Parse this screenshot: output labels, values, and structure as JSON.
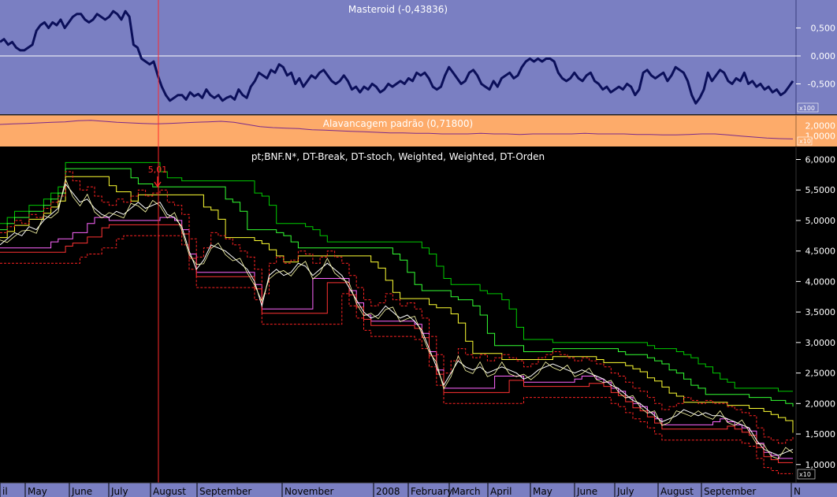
{
  "chart_data": [
    {
      "type": "line",
      "title": "Masteroid (-0,43836)",
      "multiplier_label": "x100",
      "y_ticks": [
        "0,500",
        "0,000",
        "-0,500"
      ],
      "ylim": [
        -1.0,
        1.0
      ],
      "zero_line": true,
      "colors": {
        "background": "#7a7fc2",
        "line": "#0b0f5a",
        "reference": "#ffffff"
      },
      "values": [
        0.25,
        0.3,
        0.2,
        0.25,
        0.15,
        0.1,
        0.1,
        0.15,
        0.2,
        0.45,
        0.55,
        0.6,
        0.5,
        0.6,
        0.55,
        0.65,
        0.5,
        0.6,
        0.7,
        0.75,
        0.75,
        0.65,
        0.6,
        0.65,
        0.75,
        0.7,
        0.65,
        0.7,
        0.8,
        0.75,
        0.65,
        0.8,
        0.7,
        0.2,
        0.15,
        -0.05,
        -0.1,
        -0.15,
        -0.1,
        -0.35,
        -0.55,
        -0.7,
        -0.8,
        -0.75,
        -0.7,
        -0.7,
        -0.78,
        -0.65,
        -0.72,
        -0.68,
        -0.75,
        -0.6,
        -0.7,
        -0.75,
        -0.7,
        -0.8,
        -0.75,
        -0.72,
        -0.78,
        -0.6,
        -0.7,
        -0.75,
        -0.55,
        -0.45,
        -0.3,
        -0.35,
        -0.4,
        -0.25,
        -0.3,
        -0.15,
        -0.2,
        -0.35,
        -0.3,
        -0.5,
        -0.4,
        -0.55,
        -0.45,
        -0.35,
        -0.4,
        -0.3,
        -0.25,
        -0.35,
        -0.45,
        -0.5,
        -0.45,
        -0.35,
        -0.45,
        -0.6,
        -0.55,
        -0.65,
        -0.55,
        -0.6,
        -0.5,
        -0.55,
        -0.65,
        -0.6,
        -0.5,
        -0.55,
        -0.5,
        -0.45,
        -0.5,
        -0.4,
        -0.45,
        -0.3,
        -0.35,
        -0.3,
        -0.4,
        -0.55,
        -0.6,
        -0.55,
        -0.35,
        -0.2,
        -0.3,
        -0.4,
        -0.5,
        -0.45,
        -0.3,
        -0.25,
        -0.35,
        -0.5,
        -0.55,
        -0.6,
        -0.45,
        -0.55,
        -0.4,
        -0.35,
        -0.3,
        -0.4,
        -0.35,
        -0.2,
        -0.1,
        -0.05,
        -0.1,
        -0.05,
        -0.1,
        -0.05,
        -0.05,
        -0.1,
        -0.3,
        -0.4,
        -0.45,
        -0.4,
        -0.3,
        -0.4,
        -0.45,
        -0.35,
        -0.3,
        -0.45,
        -0.5,
        -0.6,
        -0.55,
        -0.65,
        -0.6,
        -0.55,
        -0.6,
        -0.5,
        -0.55,
        -0.7,
        -0.6,
        -0.3,
        -0.25,
        -0.35,
        -0.4,
        -0.35,
        -0.3,
        -0.45,
        -0.35,
        -0.2,
        -0.25,
        -0.3,
        -0.45,
        -0.7,
        -0.85,
        -0.75,
        -0.6,
        -0.3,
        -0.45,
        -0.35,
        -0.25,
        -0.3,
        -0.45,
        -0.5,
        -0.4,
        -0.45,
        -0.3,
        -0.5,
        -0.45,
        -0.55,
        -0.5,
        -0.6,
        -0.55,
        -0.65,
        -0.6,
        -0.7,
        -0.65,
        -0.55,
        -0.45
      ]
    },
    {
      "type": "line",
      "title": "Alavancagem padrão (0,71800)",
      "multiplier_label": "x10",
      "y_ticks": [
        "2,0000",
        "1,0000"
      ],
      "ylim": [
        0.0,
        3.0
      ],
      "colors": {
        "background": "#fdab6a",
        "line": "#7a2a8a"
      },
      "values": [
        2.1,
        2.15,
        2.2,
        2.25,
        2.3,
        2.35,
        2.45,
        2.5,
        2.4,
        2.3,
        2.25,
        2.2,
        2.15,
        2.2,
        2.25,
        2.3,
        2.35,
        2.4,
        2.3,
        2.1,
        1.9,
        1.8,
        1.75,
        1.7,
        1.6,
        1.55,
        1.5,
        1.45,
        1.4,
        1.35,
        1.3,
        1.3,
        1.25,
        1.25,
        1.2,
        1.2,
        1.2,
        1.25,
        1.2,
        1.2,
        1.15,
        1.2,
        1.2,
        1.2,
        1.2,
        1.25,
        1.2,
        1.2,
        1.2,
        1.15,
        1.15,
        1.1,
        1.1,
        1.15,
        1.2,
        1.2,
        1.1,
        1.0,
        0.9,
        0.8,
        0.75,
        0.72
      ]
    },
    {
      "type": "line",
      "title": "pt;BNF.N*, DT-Break, DT-stoch, Weighted, Weighted, DT-Orden",
      "multiplier_label": "x10",
      "y_ticks": [
        "6,0000",
        "5,5000",
        "5,0000",
        "4,5000",
        "4,0000",
        "3,5000",
        "3,0000",
        "2,5000",
        "2,0000",
        "1,5000",
        "1,0000"
      ],
      "ylim": [
        0.7,
        6.2
      ],
      "x_tick_labels": [
        "il",
        "May",
        "June",
        "July",
        "August",
        "September",
        "November",
        "2008",
        "February",
        "March",
        "April",
        "May",
        "June",
        "July",
        "August",
        "September",
        "N"
      ],
      "annotation": {
        "text": "5,01",
        "color": "#ff2a2a"
      },
      "cursor_line_color": "#ff2a2a",
      "colors": {
        "background": "#000000",
        "price": "#ffffff",
        "trail_1": "#33ff33",
        "trail_2": "#00cc00",
        "trail_3": "#ffff33",
        "trail_4": "#ff66ff",
        "trail_5": "#ff3333",
        "band": "#ff2222"
      },
      "price": [
        4.6,
        4.7,
        4.8,
        4.75,
        4.9,
        4.85,
        5.0,
        5.1,
        5.2,
        5.6,
        5.45,
        5.3,
        5.35,
        5.2,
        5.1,
        5.05,
        5.15,
        5.1,
        5.2,
        5.3,
        5.2,
        5.25,
        5.3,
        5.1,
        5.05,
        4.9,
        4.5,
        4.2,
        4.35,
        4.6,
        4.55,
        4.5,
        4.4,
        4.3,
        4.2,
        4.0,
        3.6,
        4.1,
        4.2,
        4.1,
        4.15,
        4.3,
        4.25,
        4.1,
        4.2,
        4.3,
        4.2,
        4.1,
        3.9,
        3.7,
        3.5,
        3.4,
        3.45,
        3.6,
        3.5,
        3.4,
        3.45,
        3.35,
        3.2,
        2.9,
        2.6,
        2.3,
        2.5,
        2.7,
        2.6,
        2.55,
        2.6,
        2.5,
        2.55,
        2.6,
        2.55,
        2.5,
        2.4,
        2.45,
        2.55,
        2.6,
        2.65,
        2.6,
        2.55,
        2.5,
        2.55,
        2.5,
        2.45,
        2.4,
        2.3,
        2.25,
        2.15,
        2.05,
        2.0,
        1.9,
        1.8,
        1.7,
        1.75,
        1.8,
        1.9,
        1.85,
        1.8,
        1.85,
        1.8,
        1.8,
        1.75,
        1.7,
        1.65,
        1.6,
        1.4,
        1.25,
        1.2,
        1.15,
        1.2,
        1.25
      ]
    }
  ]
}
